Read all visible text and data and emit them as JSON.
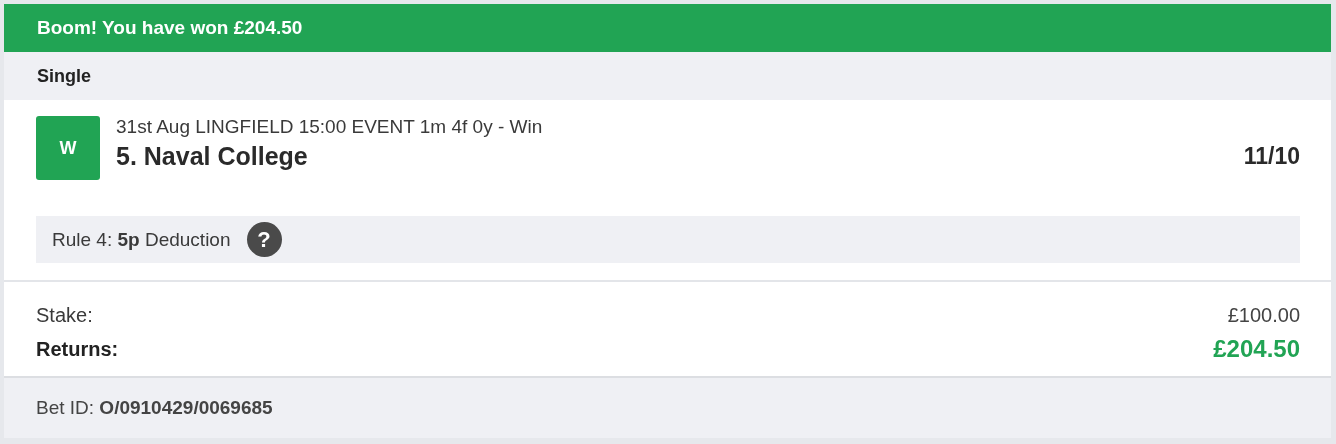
{
  "banner": {
    "text": "Boom! You have won £204.50"
  },
  "bet_type": "Single",
  "selection": {
    "result_badge": "W",
    "event": "31st Aug LINGFIELD 15:00 EVENT 1m 4f 0y - Win",
    "name": "5. Naval College",
    "odds": "11/10"
  },
  "rule4": {
    "text": "Rule 4: **5p** Deduction",
    "help": "?"
  },
  "summary": {
    "stake_label": "Stake:",
    "stake_value": "£100.00",
    "returns_label": "Returns:",
    "returns_value": "£204.50"
  },
  "bet_id": "Bet ID: **O/0910429/0069685**"
}
